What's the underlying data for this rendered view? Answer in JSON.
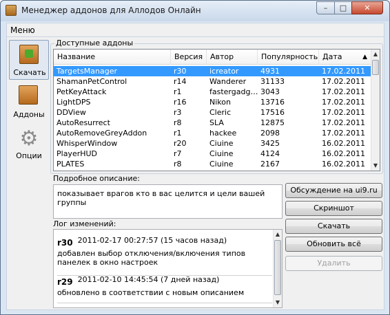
{
  "window": {
    "title": "Менеджер аддонов для Аллодов Онлайн",
    "controls": {
      "minimize": "–",
      "maximize": "□",
      "close": "✕"
    }
  },
  "menu": {
    "label": "Меню"
  },
  "nav": [
    {
      "label": "Скачать",
      "icon": "download-box-icon",
      "active": true
    },
    {
      "label": "Аддоны",
      "icon": "addons-box-icon",
      "active": false
    },
    {
      "label": "Опции",
      "icon": "gear-icon",
      "active": false
    }
  ],
  "available": {
    "group_title": "Доступные аддоны",
    "columns": [
      "Название",
      "Версия",
      "Автор",
      "Популярность",
      "Дата"
    ],
    "sort_indicator": "▲",
    "rows": [
      [
        "TargetsManager",
        "r30",
        "icreator",
        "4931",
        "17.02.2011"
      ],
      [
        "ShamanPetControl",
        "r14",
        "Wanderer",
        "31133",
        "17.02.2011"
      ],
      [
        "PetKeyAttack",
        "r1",
        "fastergadg…",
        "3043",
        "17.02.2011"
      ],
      [
        "LightDPS",
        "r16",
        "Nikon",
        "13716",
        "17.02.2011"
      ],
      [
        "DDView",
        "r3",
        "Cleric",
        "17516",
        "17.02.2011"
      ],
      [
        "AutoResurrect",
        "r8",
        "SLA",
        "12875",
        "17.02.2011"
      ],
      [
        "AutoRemoveGreyAddon",
        "r1",
        "hackee",
        "2098",
        "17.02.2011"
      ],
      [
        "WhisperWindow",
        "r20",
        "Ciuine",
        "3425",
        "16.02.2011"
      ],
      [
        "PlayerHUD",
        "r7",
        "Ciuine",
        "4124",
        "16.02.2011"
      ],
      [
        "PLATES",
        "r8",
        "Ciuine",
        "2167",
        "16.02.2011"
      ]
    ],
    "selected_index": 0
  },
  "description": {
    "group_title": "Подробное описание:",
    "text": "показывает врагов кто в вас целится и цели вашей группы"
  },
  "changelog": {
    "group_title": "Лог изменений:",
    "entries": [
      {
        "version": "r30",
        "date": "2011-02-17 00:27:57 (15 часов назад)",
        "text": "добавлен выбор отключения/включения типов панелек в окно настроек"
      },
      {
        "version": "r29",
        "date": "2011-02-10 14:45:54 (7 дней назад)",
        "text": "обновлено в соответствии с новым описанием"
      }
    ]
  },
  "actions": {
    "discuss": "Обсуждение на ui9.ru",
    "screenshot": "Скриншот",
    "download": "Скачать",
    "update_all": "Обновить всё",
    "delete": "Удалить"
  },
  "colors": {
    "selection": "#3399ff",
    "window_frame": "#dbe6f3"
  }
}
